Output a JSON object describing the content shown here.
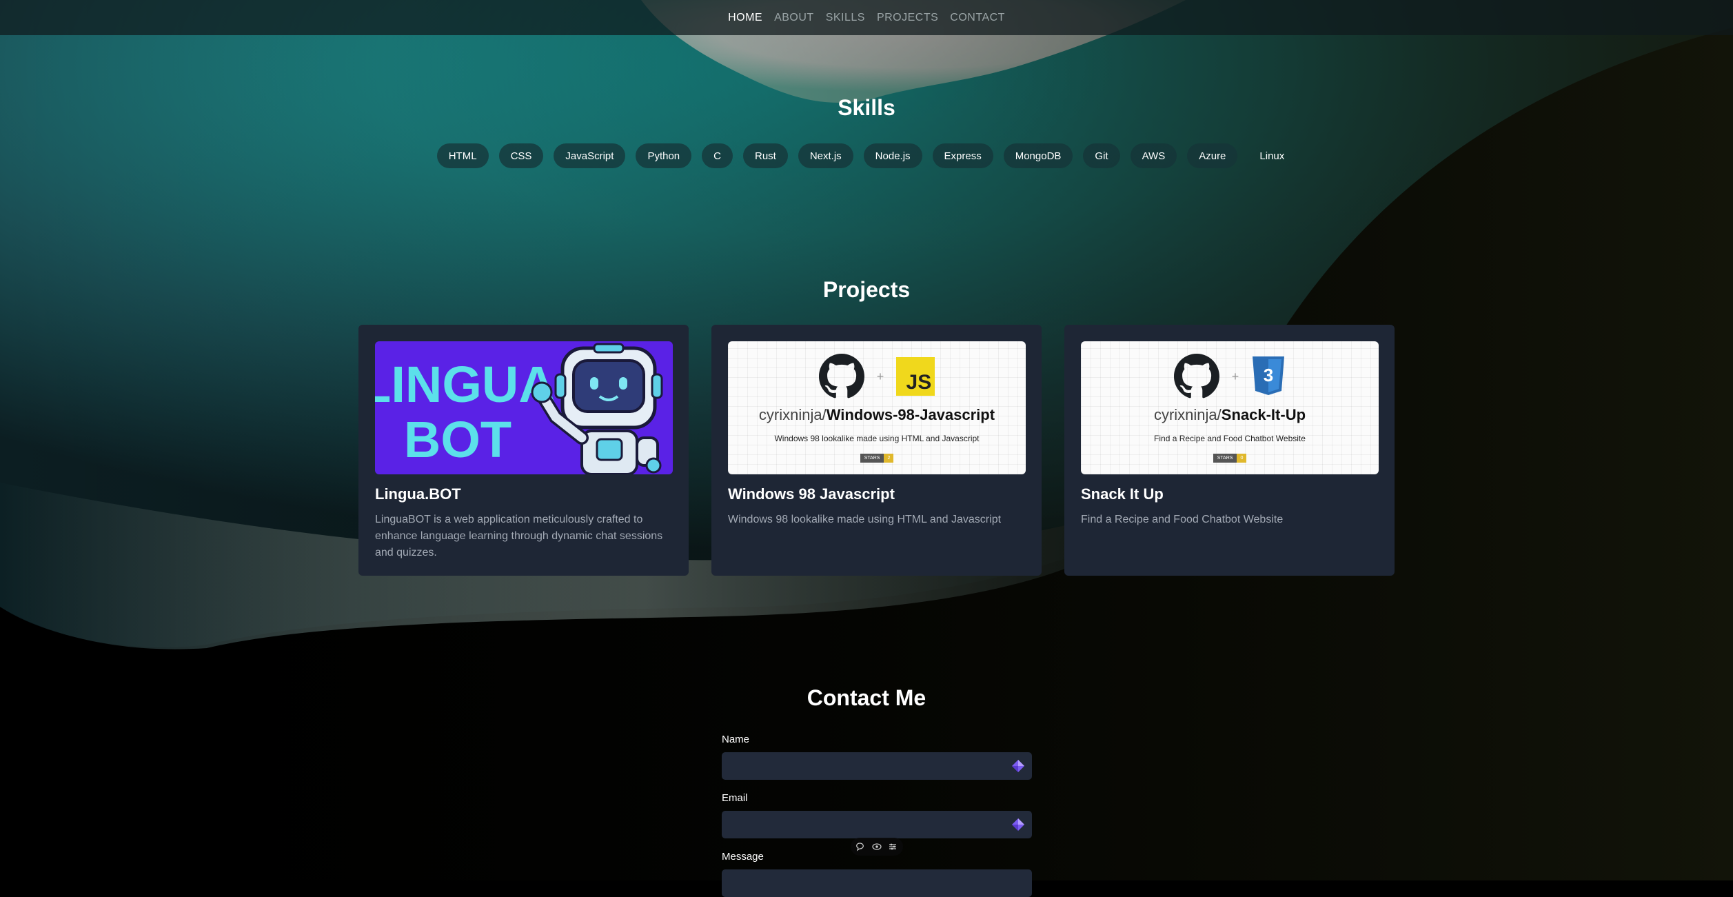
{
  "nav": {
    "items": [
      {
        "label": "HOME",
        "active": true
      },
      {
        "label": "ABOUT",
        "active": false
      },
      {
        "label": "SKILLS",
        "active": false
      },
      {
        "label": "PROJECTS",
        "active": false
      },
      {
        "label": "CONTACT",
        "active": false
      }
    ]
  },
  "skills": {
    "title": "Skills",
    "items": [
      "HTML",
      "CSS",
      "JavaScript",
      "Python",
      "C",
      "Rust",
      "Next.js",
      "Node.js",
      "Express",
      "MongoDB",
      "Git",
      "AWS",
      "Azure",
      "Linux"
    ]
  },
  "projects": {
    "title": "Projects",
    "cards": [
      {
        "name": "Lingua.BOT",
        "description": "LinguaBOT is a web application meticulously crafted to enhance language learning through dynamic chat sessions and quizzes.",
        "thumb_text_line1": "LINGUA",
        "thumb_text_line2": "BOT"
      },
      {
        "name": "Windows 98 Javascript",
        "description": "Windows 98 lookalike made using HTML and Javascript",
        "repo_owner": "cyrixninja/",
        "repo_name": "Windows-98-Javascript",
        "repo_desc": "Windows 98 lookalike made using HTML and Javascript",
        "stars_label": "STARS",
        "stars_count": "2",
        "badge": "JS"
      },
      {
        "name": "Snack It Up",
        "description": "Find a Recipe and Food Chatbot Website",
        "repo_owner": "cyrixninja/",
        "repo_name": "Snack-It-Up",
        "repo_desc": "Find a Recipe and Food Chatbot Website",
        "stars_label": "STARS",
        "stars_count": "0"
      }
    ]
  },
  "contact": {
    "title": "Contact Me",
    "name_label": "Name",
    "email_label": "Email",
    "message_label": "Message"
  },
  "colors": {
    "teal": "#1fa3a3",
    "card_bg": "#1e2635",
    "purple": "#5a22e6",
    "js_yellow": "#f0d81c",
    "css_blue": "#2a6db5"
  }
}
